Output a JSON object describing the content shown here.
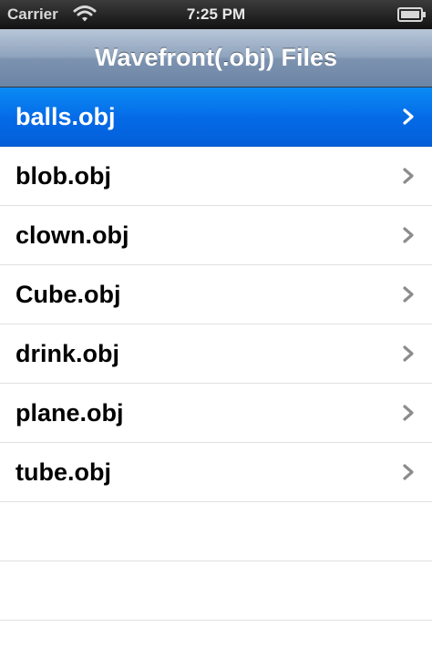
{
  "status_bar": {
    "carrier": "Carrier",
    "time": "7:25 PM",
    "icons": [
      "wifi-icon",
      "battery-icon"
    ]
  },
  "nav_bar": {
    "title": "Wavefront(.obj) Files"
  },
  "file_list": {
    "items": [
      {
        "label": "balls.obj",
        "selected": true
      },
      {
        "label": "blob.obj",
        "selected": false
      },
      {
        "label": "clown.obj",
        "selected": false
      },
      {
        "label": "Cube.obj",
        "selected": false
      },
      {
        "label": "drink.obj",
        "selected": false
      },
      {
        "label": "plane.obj",
        "selected": false
      },
      {
        "label": "tube.obj",
        "selected": false
      }
    ],
    "accessory_icon": "chevron-right-icon"
  },
  "colors": {
    "selection": "#0569e6",
    "nav_bar": "#8ea3bd",
    "separator": "#e0e0e0",
    "chevron": "#8c8c8c",
    "chevron_selected": "#ffffff"
  }
}
